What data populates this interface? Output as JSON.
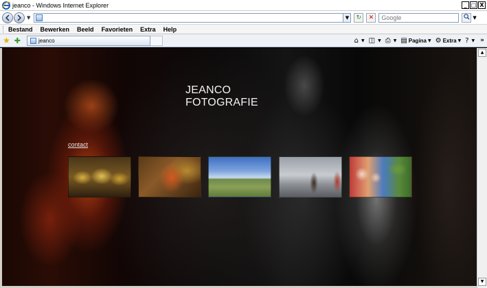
{
  "window": {
    "title": "jeanco - Windows Internet Explorer",
    "buttons": {
      "minimize": "_",
      "maximize": "□",
      "close": "X"
    }
  },
  "address_bar": {
    "url": "",
    "search_placeholder": "Google",
    "icons": [
      "back-icon",
      "forward-icon",
      "refresh-icon",
      "stop-icon",
      "search-go-icon"
    ]
  },
  "menu": {
    "items": [
      "Bestand",
      "Bewerken",
      "Beeld",
      "Favorieten",
      "Extra",
      "Help"
    ]
  },
  "tabs": {
    "items": [
      {
        "label": "jeanco"
      }
    ]
  },
  "command_bar": {
    "page_label": "Pagina",
    "extra_label": "Extra",
    "chevron": "»"
  },
  "page": {
    "title": "JEANCO FOTOGRAFIE",
    "contact_link": "contact",
    "thumbnails": [
      {
        "name": "musicians-golden"
      },
      {
        "name": "dancer-motion-blur"
      },
      {
        "name": "field-landscape"
      },
      {
        "name": "room-people"
      },
      {
        "name": "children-group"
      }
    ]
  },
  "colors": {
    "page_background": "#000000",
    "title_text": "#f2f2f2",
    "link_text": "#e6e6e6"
  }
}
